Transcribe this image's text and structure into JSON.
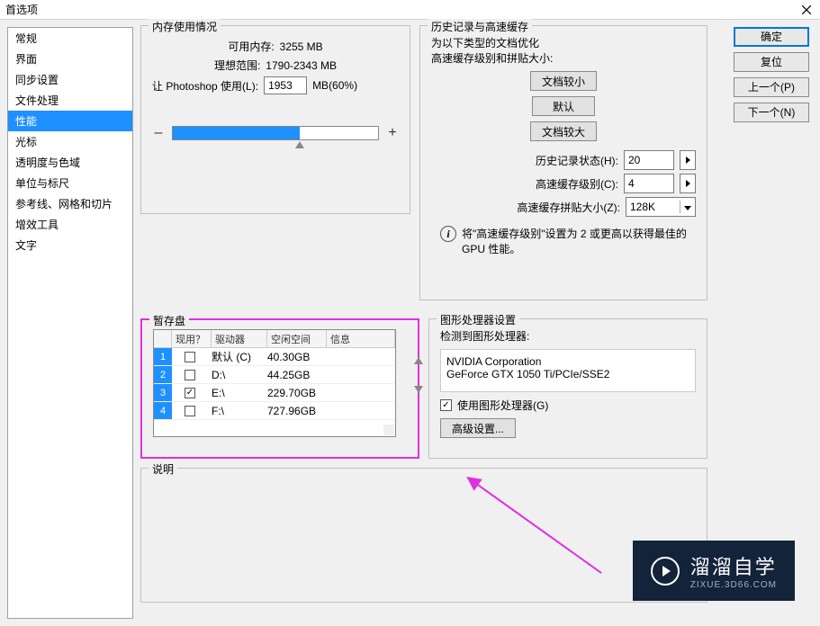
{
  "window": {
    "title": "首选项",
    "close": "×"
  },
  "sidebar": {
    "items": [
      "常规",
      "界面",
      "同步设置",
      "文件处理",
      "性能",
      "光标",
      "透明度与色域",
      "单位与标尺",
      "参考线、网格和切片",
      "增效工具",
      "文字"
    ],
    "selected_index": 4
  },
  "buttons": {
    "ok": "确定",
    "reset": "复位",
    "prev": "上一个(P)",
    "next": "下一个(N)"
  },
  "memory": {
    "legend": "内存使用情况",
    "available_label": "可用内存:",
    "available_value": "3255 MB",
    "ideal_label": "理想范围:",
    "ideal_value": "1790-2343 MB",
    "let_label": "让 Photoshop 使用(L):",
    "let_value": "1953",
    "unit_pct": "MB(60%)",
    "minus": "–",
    "plus": "+"
  },
  "history": {
    "legend": "历史记录与高速缓存",
    "optimize_for": "为以下类型的文档优化",
    "cache_tile_label": "高速缓存级别和拼贴大小:",
    "btn_small": "文档较小",
    "btn_default": "默认",
    "btn_big": "文档较大",
    "hist_states_label": "历史记录状态(H):",
    "hist_states_value": "20",
    "cache_levels_label": "高速缓存级别(C):",
    "cache_levels_value": "4",
    "tile_size_label": "高速缓存拼贴大小(Z):",
    "tile_size_value": "128K",
    "note": "将\"高速缓存级别\"设置为 2 或更高以获得最佳的 GPU 性能。"
  },
  "scratch": {
    "legend": "暂存盘",
    "cols": {
      "num": "",
      "active": "现用？",
      "drive": "驱动器",
      "free": "空闲空间",
      "info": "信息"
    },
    "rows": [
      {
        "n": "1",
        "active": false,
        "drive": "默认 (C)",
        "free": "40.30GB"
      },
      {
        "n": "2",
        "active": false,
        "drive": "D:\\",
        "free": "44.25GB"
      },
      {
        "n": "3",
        "active": true,
        "drive": "E:\\",
        "free": "229.70GB"
      },
      {
        "n": "4",
        "active": false,
        "drive": "F:\\",
        "free": "727.96GB"
      }
    ]
  },
  "gpu": {
    "legend": "图形处理器设置",
    "detected_label": "检测到图形处理器:",
    "vendor": "NVIDIA Corporation",
    "model": "GeForce GTX 1050 Ti/PCIe/SSE2",
    "use_gpu": "使用图形处理器(G)",
    "advanced": "高级设置..."
  },
  "desc": {
    "legend": "说明"
  },
  "watermark": {
    "big": "溜溜自学",
    "small": "ZIXUE.3D66.COM"
  }
}
